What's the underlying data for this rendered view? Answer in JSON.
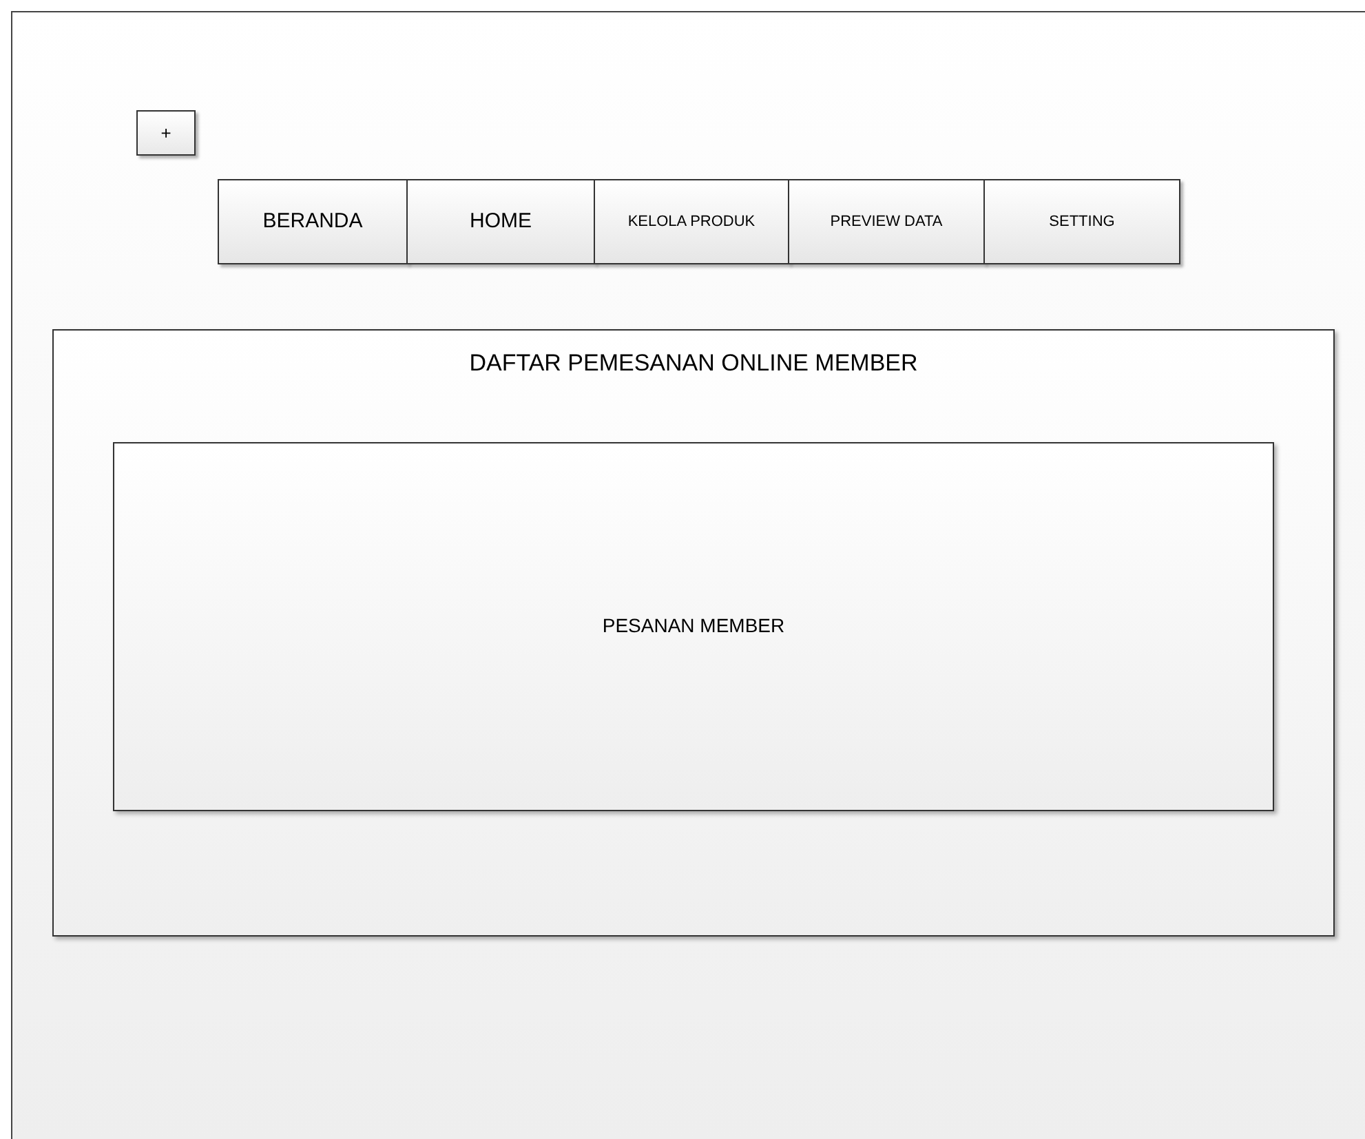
{
  "add_button": {
    "label": "+"
  },
  "tabs": [
    {
      "label": "BERANDA",
      "kind": "main"
    },
    {
      "label": "HOME",
      "kind": "main"
    },
    {
      "label": "KELOLA PRODUK",
      "kind": "sub"
    },
    {
      "label": "PREVIEW DATA",
      "kind": "sub"
    },
    {
      "label": "SETTING",
      "kind": "sub"
    }
  ],
  "panel": {
    "title": "DAFTAR PEMESANAN ONLINE MEMBER",
    "content": "PESANAN MEMBER"
  }
}
